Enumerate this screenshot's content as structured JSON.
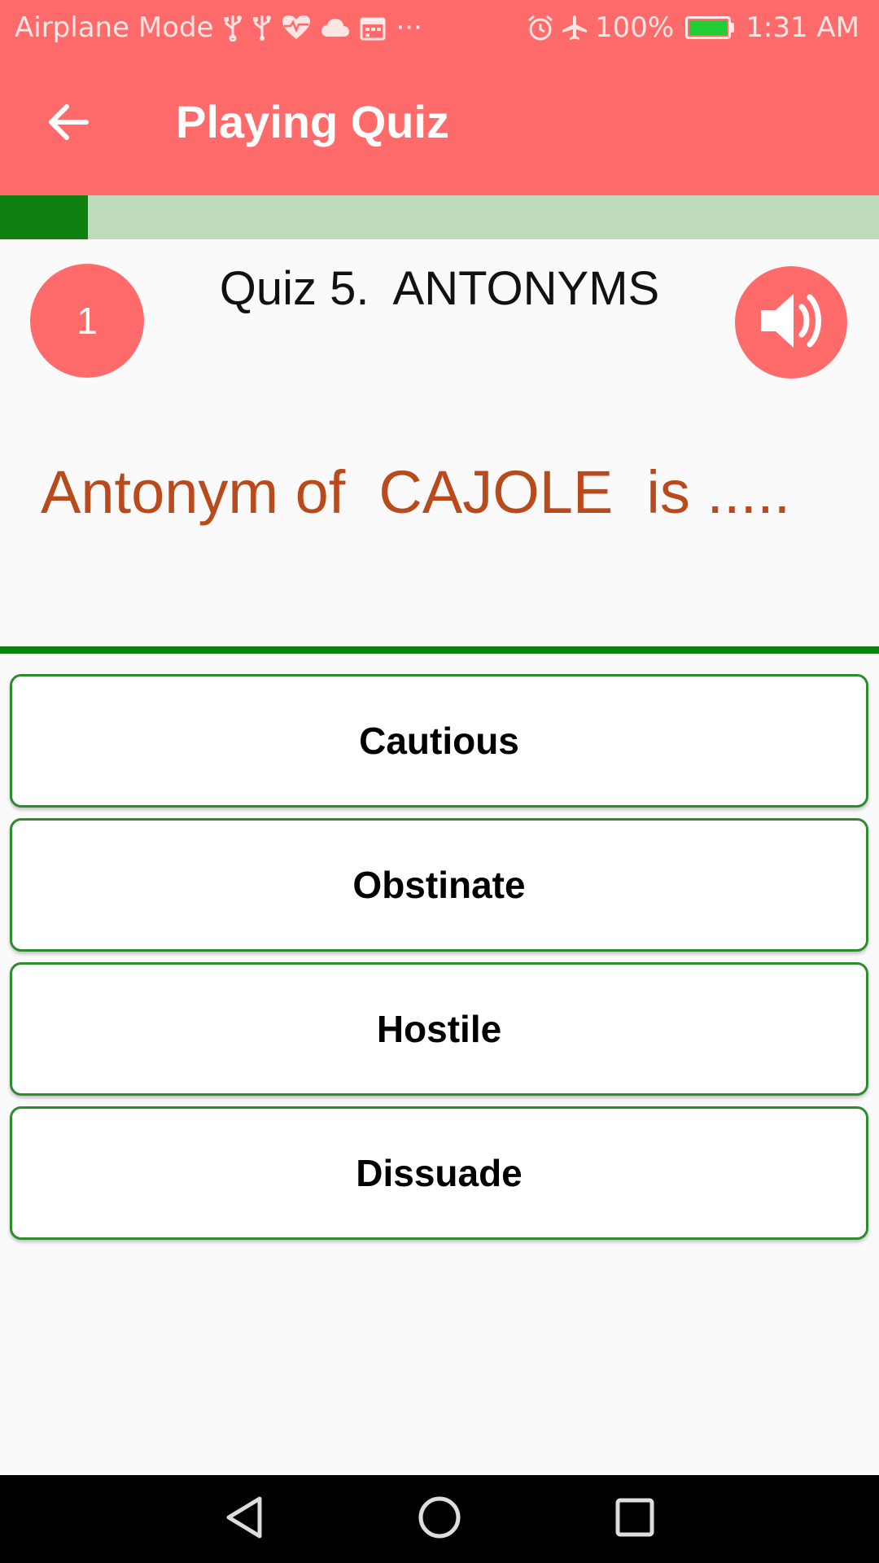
{
  "status_bar": {
    "left_text": "Airplane Mode",
    "left_icons": [
      "usb-icon",
      "usb-icon",
      "heart-monitor-icon",
      "cloud-icon",
      "calendar-icon",
      "more-notifications-icon"
    ],
    "more_label": "···",
    "right_icons": [
      "alarm-icon",
      "airplane-icon"
    ],
    "battery": "100%",
    "battery_level": 1.0,
    "time": "1:31 AM"
  },
  "app_bar": {
    "title": "Playing Quiz",
    "back_icon": "arrow-back-icon",
    "background_color": "#ff6b6b"
  },
  "progress": {
    "value": 0.1,
    "fill_color": "#0f8110",
    "track_color": "#bedcbb"
  },
  "quiz": {
    "question_number": "1",
    "title": "Quiz 5.  ANTONYMS",
    "sound_icon": "volume-icon",
    "question": "Antonym of  CAJOLE  is .....",
    "question_color": "#b94a1c"
  },
  "options": [
    {
      "label": "Cautious"
    },
    {
      "label": "Obstinate"
    },
    {
      "label": "Hostile"
    },
    {
      "label": "Dissuade"
    }
  ],
  "nav_bar": {
    "icons": [
      "back-triangle-icon",
      "home-circle-icon",
      "recents-square-icon"
    ]
  }
}
